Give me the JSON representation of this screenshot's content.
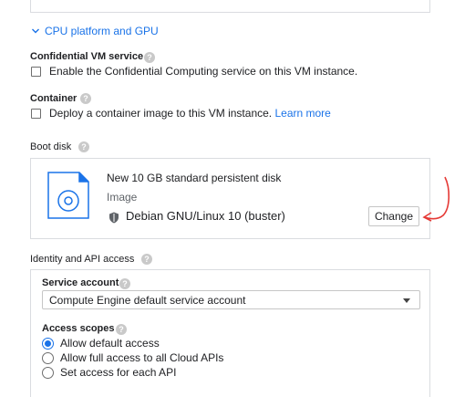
{
  "cpu_platform": {
    "label": "CPU platform and GPU"
  },
  "confidential_vm": {
    "title": "Confidential VM service",
    "checkbox_label": "Enable the Confidential Computing service on this VM instance."
  },
  "container": {
    "title": "Container",
    "checkbox_label": "Deploy a container image to this VM instance.",
    "learn_more": "Learn more"
  },
  "boot_disk": {
    "title": "Boot disk",
    "disk_description": "New 10 GB standard persistent disk",
    "image_label": "Image",
    "image_name": "Debian GNU/Linux 10 (buster)",
    "change_button": "Change"
  },
  "identity": {
    "title": "Identity and API access",
    "service_account_label": "Service account",
    "service_account_value": "Compute Engine default service account",
    "access_scopes_label": "Access scopes",
    "scopes": [
      {
        "label": "Allow default access",
        "selected": true
      },
      {
        "label": "Allow full access to all Cloud APIs",
        "selected": false
      },
      {
        "label": "Set access for each API",
        "selected": false
      }
    ]
  },
  "help_icon": "?",
  "colors": {
    "accent": "#1a73e8",
    "annotation": "#e53935"
  }
}
